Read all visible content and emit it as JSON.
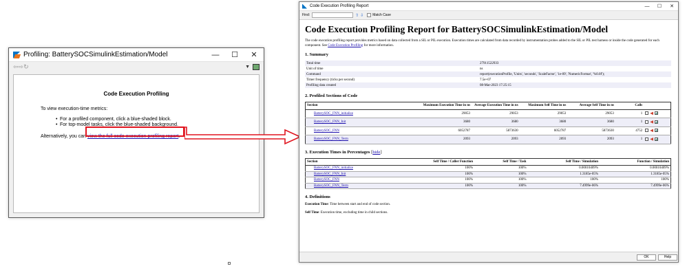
{
  "win1": {
    "title": "Profiling: BatterySOCSimulinkEstimation/Model",
    "controls": {
      "minimize": "—",
      "maximize": "☐",
      "close": "✕"
    },
    "toolbar": {
      "back": "⇦",
      "forward": "⇨",
      "refresh": "↻",
      "dropdown": "▼"
    },
    "heading": "Code Execution Profiling",
    "intro": "To view execution-time metrics:",
    "bullets": [
      "For a profiled component, click a blue-shaded block.",
      "For top-model tasks, click the blue-shaded background."
    ],
    "alt_text": "Alternatively, you can",
    "link": "view the full code execution profiling report",
    "period": "."
  },
  "win2": {
    "title": "Code Execution Profiling Report",
    "controls": {
      "minimize": "—",
      "maximize": "☐",
      "close": "✕"
    },
    "find_label": "Find:",
    "find_up": "⇧",
    "find_down": "⇩",
    "match_case": "Match Case",
    "report_title": "Code Execution Profiling Report for BatterySOCSimulinkEstimation/Model",
    "intro_part1": "The code execution profiling report provides metrics based on data collected from a SIL or PIL execution. Execution times are calculated from data recorded by instrumentation probes added to the SIL or PIL test harness or inside the code generated for each component. See",
    "intro_link": "Code Execution Profiling",
    "intro_part2": "for more information.",
    "summary_heading": "1. Summary",
    "summary": [
      {
        "label": "Total time",
        "value": "27911522933"
      },
      {
        "label": "Unit of time",
        "value": "ns"
      },
      {
        "label": "Command",
        "value": "report(executionProfile, 'Units', 'seconds', 'ScaleFactor', '1e-09', 'NumericFormat', '%0.0f');"
      },
      {
        "label": "Timer frequency (ticks per second)",
        "value": "7.5e+07"
      },
      {
        "label": "Profiling data created",
        "value": "08-Mar-2023 17:25:15"
      }
    ],
    "profiled_heading": "2. Profiled Sections of Code",
    "profiled_headers": [
      "Section",
      "Maximum Execution Time in ns",
      "Average Execution Time in ns",
      "Maximum Self Time in ns",
      "Average Self Time in ns",
      "Calls"
    ],
    "profiled_rows": [
      {
        "section": "BatterySOC_FNN_initialize",
        "max_exec": "29053",
        "avg_exec": "29053",
        "max_self": "29053",
        "avg_self": "29053",
        "calls": "1"
      },
      {
        "section": "BatterySOC_FNN_Init",
        "max_exec": "3680",
        "avg_exec": "3680",
        "max_self": "3680",
        "avg_self": "3680",
        "calls": "1"
      },
      {
        "section": "BatterySOC_FNN",
        "max_exec": "6052787",
        "avg_exec": "5873630",
        "max_self": "6052787",
        "avg_self": "5873630",
        "calls": "4752"
      },
      {
        "section": "BatterySOC_FNN_Term",
        "max_exec": "2093",
        "avg_exec": "2093",
        "max_self": "2093",
        "avg_self": "2093",
        "calls": "1"
      }
    ],
    "percent_heading": "3. Execution Times in Percentages",
    "hide_open": "[",
    "hide_link": "hide",
    "hide_close": "]",
    "percent_headers": [
      "Section",
      "Self Time / Caller Function",
      "Self Time / Task",
      "Self Time / Simulation",
      "Function / Simulation"
    ],
    "percent_rows": [
      {
        "section": "BatterySOC_FNN_initialize",
        "caller": "100%",
        "task": "100%",
        "sim": "0.00010409%",
        "func": "0.00010409%"
      },
      {
        "section": "BatterySOC_FNN_Init",
        "caller": "100%",
        "task": "100%",
        "sim": "1.3185e-05%",
        "func": "1.3185e-05%"
      },
      {
        "section": "BatterySOC_FNN",
        "caller": "100%",
        "task": "100%",
        "sim": "100%",
        "func": "100%"
      },
      {
        "section": "BatterySOC_FNN_Term",
        "caller": "100%",
        "task": "100%",
        "sim": "7.4999e-06%",
        "func": "7.4999e-06%"
      }
    ],
    "defs_heading": "4. Definitions",
    "defs": [
      {
        "term": "Execution Time",
        "desc": ": Time between start and end of code section."
      },
      {
        "term": "Self Time",
        "desc": ": Execution time, excluding time in child sections."
      }
    ],
    "ok": "OK",
    "help": "Help"
  },
  "colors": {
    "link": "#1a0dab",
    "highlight": "#e0141e",
    "row_shade": "#eeeef8"
  }
}
